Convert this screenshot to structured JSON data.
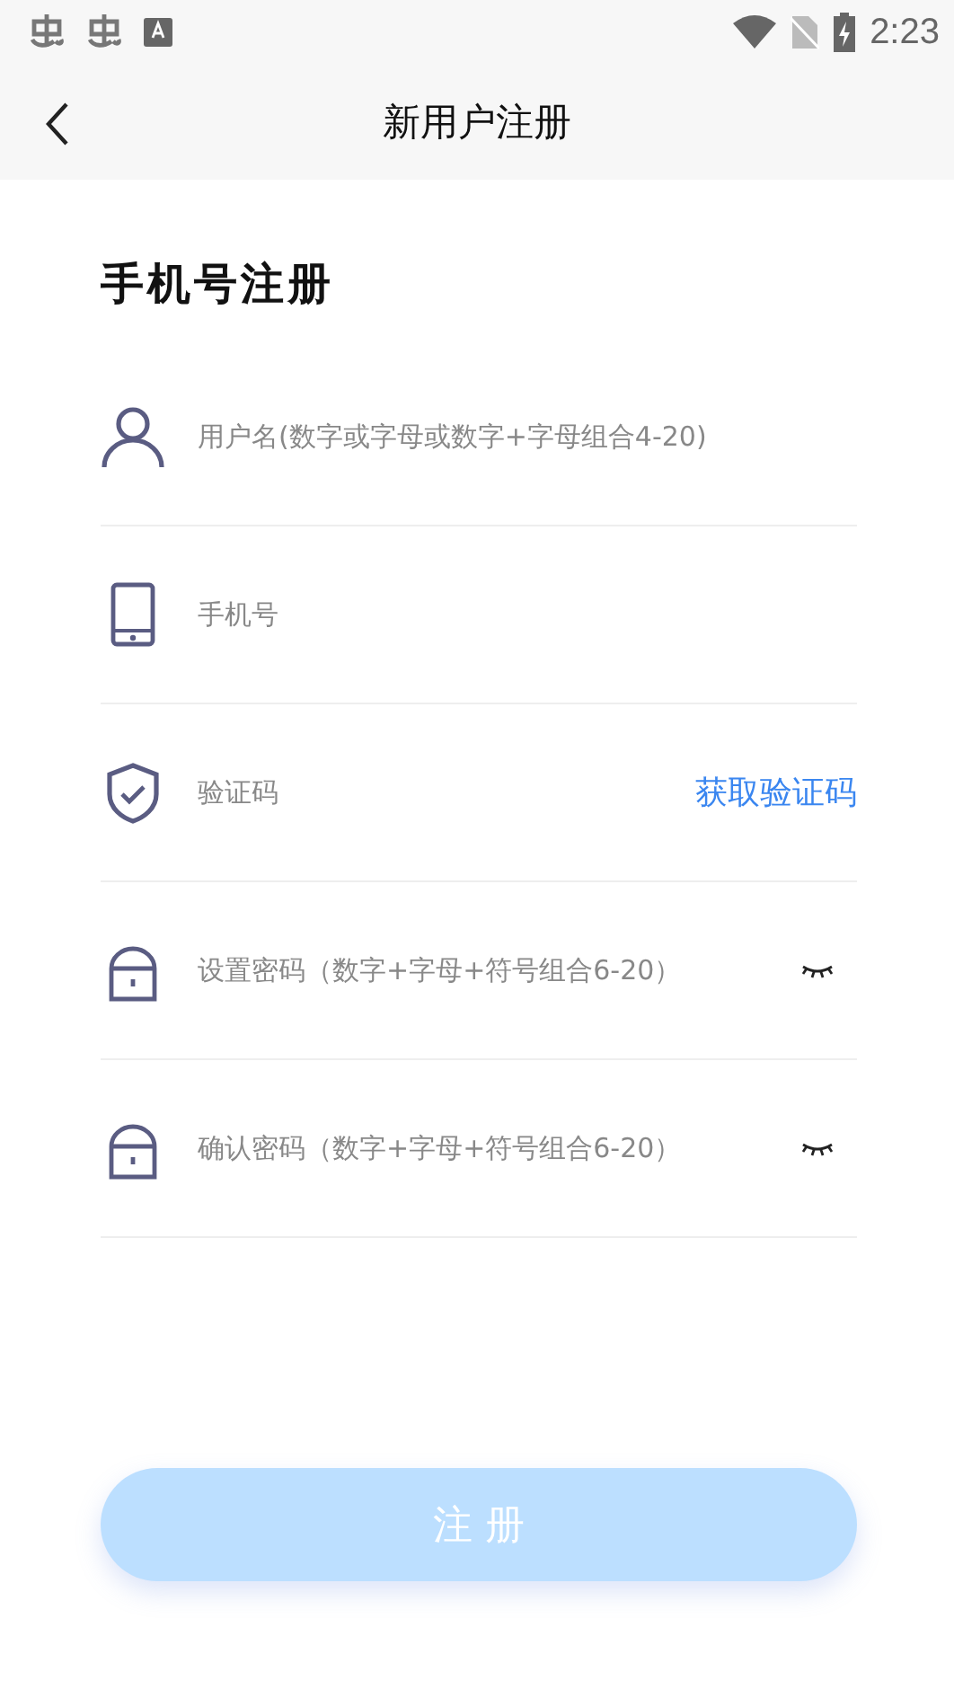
{
  "status_bar": {
    "time": "2:23"
  },
  "header": {
    "title": "新用户注册"
  },
  "heading": "手机号注册",
  "fields": [
    {
      "kind": "user",
      "placeholder": "用户名(数字或字母或数字+字母组合4-20)"
    },
    {
      "kind": "phone",
      "placeholder": "手机号"
    },
    {
      "kind": "code",
      "placeholder": "验证码",
      "action": "获取验证码"
    },
    {
      "kind": "password",
      "placeholder": "设置密码（数字+字母+符号组合6-20）",
      "visible": false
    },
    {
      "kind": "password",
      "placeholder": "确认密码（数字+字母+符号组合6-20）",
      "visible": false
    }
  ],
  "submit": {
    "label": "注 册",
    "disabled": true
  }
}
